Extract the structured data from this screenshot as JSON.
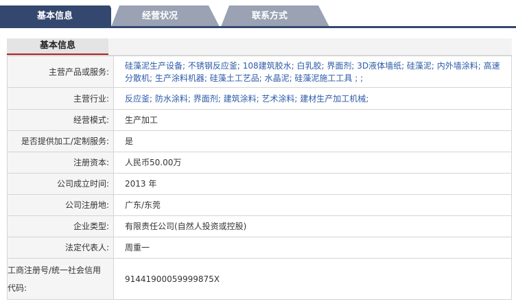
{
  "tabs": [
    {
      "label": "基本信息",
      "active": true
    },
    {
      "label": "经营状况",
      "active": false
    },
    {
      "label": "联系方式",
      "active": false
    }
  ],
  "section": {
    "title": "基本信息"
  },
  "rows": [
    {
      "label": "主营产品或服务:",
      "value": "硅藻泥生产设备; 不锈钢反应釜; 108建筑胶水; 白乳胶; 界面剂; 3D液体墙纸; 硅藻泥; 内外墙涂料; 高速分散机; 生产涂料机器; 硅藻土工艺品; 水晶泥; 硅藻泥施工工具 ; ;"
    },
    {
      "label": "主营行业:",
      "value": "反应釜; 防水涂料; 界面剂; 建筑涂料; 艺术涂料; 建材生产加工机械;"
    },
    {
      "label": "经营模式:",
      "value": "生产加工"
    },
    {
      "label": "是否提供加工/定制服务:",
      "value": "是"
    },
    {
      "label": "注册资本:",
      "value": "人民币50.00万"
    },
    {
      "label": "公司成立时间:",
      "value": "2013 年"
    },
    {
      "label": "公司注册地:",
      "value": "广东/东莞"
    },
    {
      "label": "企业类型:",
      "value": "有限责任公司(自然人投资或控股)"
    },
    {
      "label": "法定代表人:",
      "value": "周重一"
    },
    {
      "label": "工商注册号/统一社会信用代码:",
      "value": "91441900059999875X"
    }
  ],
  "colors": {
    "tab_active": "#34476e",
    "tab_inactive": "#9aa2b3",
    "link": "#2b5aa8",
    "accent_red": "#b22222"
  }
}
